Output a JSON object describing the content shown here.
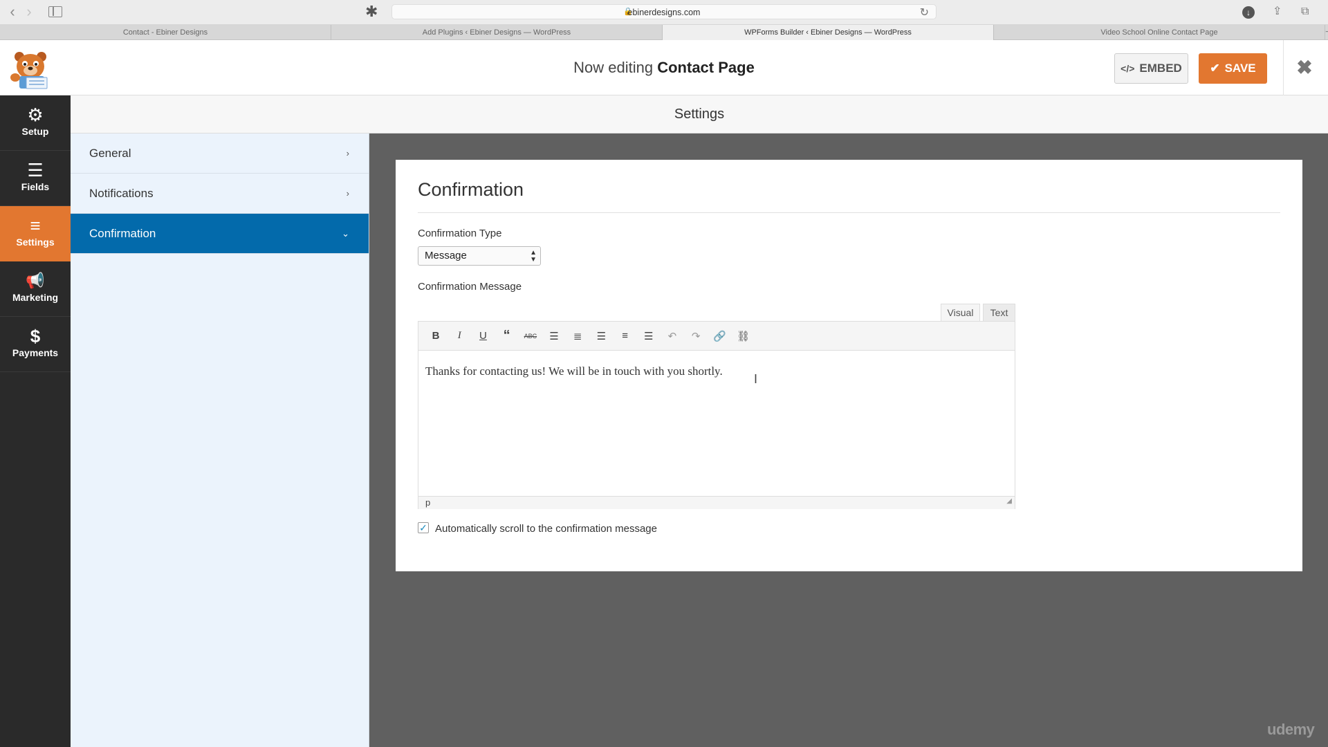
{
  "browser": {
    "url": "ebinerdesigns.com",
    "tabs": [
      {
        "title": "Contact - Ebiner Designs"
      },
      {
        "title": "Add Plugins ‹ Ebiner Designs — WordPress"
      },
      {
        "title": "WPForms Builder ‹ Ebiner Designs — WordPress"
      },
      {
        "title": "Video School Online Contact Page"
      }
    ],
    "new_tab": "+"
  },
  "header": {
    "editing_prefix": "Now editing",
    "form_name": "Contact Page",
    "embed_label": "EMBED",
    "embed_icon": "</>",
    "save_label": "SAVE",
    "save_icon": "✔",
    "close_icon": "✖"
  },
  "left_nav": {
    "items": [
      {
        "label": "Setup",
        "icon": "gear-icon",
        "glyph": "⚙"
      },
      {
        "label": "Fields",
        "icon": "list-icon",
        "glyph": "☰"
      },
      {
        "label": "Settings",
        "icon": "sliders-icon",
        "glyph": "≡"
      },
      {
        "label": "Marketing",
        "icon": "megaphone-icon",
        "glyph": "📢"
      },
      {
        "label": "Payments",
        "icon": "dollar-icon",
        "glyph": "$"
      }
    ],
    "active": "Settings"
  },
  "settings": {
    "title": "Settings",
    "panels": [
      {
        "label": "General",
        "chevron": "›"
      },
      {
        "label": "Notifications",
        "chevron": "›"
      },
      {
        "label": "Confirmation",
        "chevron": "⌄"
      }
    ],
    "active_panel": "Confirmation"
  },
  "confirmation": {
    "title": "Confirmation",
    "type_label": "Confirmation Type",
    "type_value": "Message",
    "message_label": "Confirmation Message",
    "editor_tabs": {
      "visual": "Visual",
      "text": "Text"
    },
    "message_text": "Thanks for contacting us! We will be in touch with you shortly.",
    "status_path": "p",
    "auto_scroll_label": "Automatically scroll to the confirmation message",
    "auto_scroll_checked": true,
    "checkbox_glyph": "✓"
  },
  "watermark": "udemy"
}
